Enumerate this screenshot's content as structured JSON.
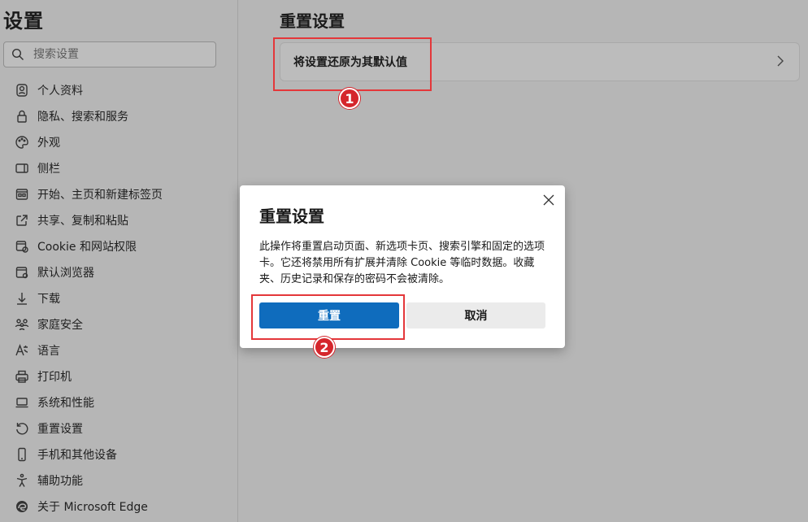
{
  "sidebar": {
    "title": "设置",
    "search": {
      "placeholder": "搜索设置"
    },
    "items": [
      {
        "label": "个人资料",
        "icon": "profile-icon"
      },
      {
        "label": "隐私、搜索和服务",
        "icon": "lock-icon"
      },
      {
        "label": "外观",
        "icon": "palette-icon"
      },
      {
        "label": "侧栏",
        "icon": "sidebar-icon"
      },
      {
        "label": "开始、主页和新建标签页",
        "icon": "home-tab-icon"
      },
      {
        "label": "共享、复制和粘贴",
        "icon": "share-icon"
      },
      {
        "label": "Cookie 和网站权限",
        "icon": "site-permissions-icon"
      },
      {
        "label": "默认浏览器",
        "icon": "browser-icon"
      },
      {
        "label": "下载",
        "icon": "download-icon"
      },
      {
        "label": "家庭安全",
        "icon": "family-icon"
      },
      {
        "label": "语言",
        "icon": "language-icon"
      },
      {
        "label": "打印机",
        "icon": "printer-icon"
      },
      {
        "label": "系统和性能",
        "icon": "laptop-icon"
      },
      {
        "label": "重置设置",
        "icon": "reset-icon"
      },
      {
        "label": "手机和其他设备",
        "icon": "phone-icon"
      },
      {
        "label": "辅助功能",
        "icon": "accessibility-icon"
      },
      {
        "label": "关于 Microsoft Edge",
        "icon": "edge-logo-icon"
      }
    ]
  },
  "main": {
    "title": "重置设置",
    "card": {
      "label": "将设置还原为其默认值"
    }
  },
  "dialog": {
    "title": "重置设置",
    "body": "此操作将重置启动页面、新选项卡页、搜索引擎和固定的选项卡。它还将禁用所有扩展并清除 Cookie 等临时数据。收藏夹、历史记录和保存的密码不会被清除。",
    "confirm_label": "重置",
    "cancel_label": "取消"
  },
  "annotations": {
    "step1": "1",
    "step2": "2"
  },
  "colors": {
    "accent": "#0f6cbd",
    "callout": "#e4373a",
    "overlay": "#b6b6b6"
  }
}
